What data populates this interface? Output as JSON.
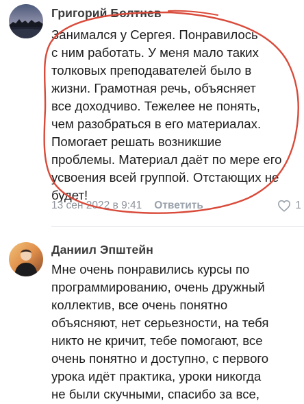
{
  "comments": [
    {
      "author": "Григорий Болтнев",
      "avatar_icon": "landscape-avatar-icon",
      "lines": [
        "Занимался у Сергея. Понравилось",
        "с ним работать. У меня мало таких",
        "толковых преподавателей было в",
        "жизни. Грамотная речь, объясняет",
        "все доходчиво. Тежелее не понять,",
        "чем разобраться в его материалах.",
        "Помогает решать возникшие",
        "проблемы. Материал даёт по мере его",
        "усвоения всей группой. Отстающих не",
        "будет!"
      ],
      "date": "13 сен 2022 в 9:41",
      "reply_label": "Ответить",
      "like_icon": "heart-icon",
      "like_count": "1"
    },
    {
      "author": "Даниил Эпштейн",
      "avatar_icon": "person-avatar-icon",
      "lines": [
        "Мне очень понравились курсы по",
        "программированию, очень дружный",
        "коллектив, все очень понятно",
        "объясняют, нет серьезности, на тебя",
        "никто не кричит, тебе помогают, все",
        "очень понятно и доступно, с первого",
        "урока идёт практика, уроки никогда",
        "не были скучными, спасибо за все,"
      ]
    }
  ],
  "colors": {
    "author": "#3a3a3a",
    "text": "#1d1d1d",
    "meta": "#8f959c",
    "annotation": "#d94a3a"
  }
}
